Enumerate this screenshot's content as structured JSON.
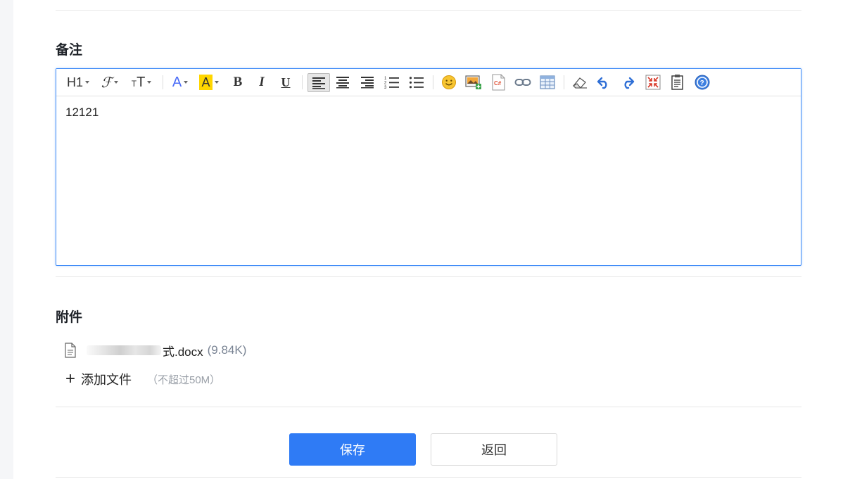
{
  "notes": {
    "title": "备注",
    "content": "12121",
    "toolbar": [
      {
        "name": "heading-button",
        "label": "H1"
      },
      {
        "name": "font-family-button",
        "icon": "font-family-icon"
      },
      {
        "name": "font-size-button",
        "icon": "font-size-icon"
      },
      {
        "name": "font-color-button",
        "icon": "font-color-icon"
      },
      {
        "name": "highlight-color-button",
        "icon": "highlight-icon"
      },
      {
        "name": "bold-button",
        "label": "B"
      },
      {
        "name": "italic-button",
        "label": "I"
      },
      {
        "name": "underline-button",
        "label": "U"
      },
      {
        "name": "align-left-button",
        "icon": "align-left-icon",
        "active": true
      },
      {
        "name": "align-center-button",
        "icon": "align-center-icon"
      },
      {
        "name": "align-right-button",
        "icon": "align-right-icon"
      },
      {
        "name": "ordered-list-button",
        "icon": "ordered-list-icon"
      },
      {
        "name": "unordered-list-button",
        "icon": "unordered-list-icon"
      },
      {
        "name": "emoji-button",
        "icon": "emoji-icon"
      },
      {
        "name": "insert-image-button",
        "icon": "image-icon"
      },
      {
        "name": "insert-code-button",
        "icon": "code-icon",
        "label": "C#"
      },
      {
        "name": "insert-link-button",
        "icon": "link-icon"
      },
      {
        "name": "insert-table-button",
        "icon": "table-icon"
      },
      {
        "name": "clear-format-button",
        "icon": "eraser-icon"
      },
      {
        "name": "undo-button",
        "icon": "undo-icon"
      },
      {
        "name": "redo-button",
        "icon": "redo-icon"
      },
      {
        "name": "fullscreen-button",
        "icon": "fullscreen-icon"
      },
      {
        "name": "paste-text-button",
        "icon": "clipboard-icon"
      },
      {
        "name": "help-button",
        "icon": "help-icon"
      }
    ]
  },
  "attachments": {
    "title": "附件",
    "files": [
      {
        "name_visible_suffix": "式.docx",
        "size": "(9.84K)"
      }
    ],
    "add_plus": "+",
    "add_label": "添加文件",
    "add_hint": "（不超过50M）"
  },
  "actions": {
    "save_label": "保存",
    "back_label": "返回"
  },
  "colors": {
    "primary": "#2f7bf5",
    "editor_border": "#3d8af7",
    "highlight": "#ffd600",
    "font_color": "#4a6cf7"
  }
}
